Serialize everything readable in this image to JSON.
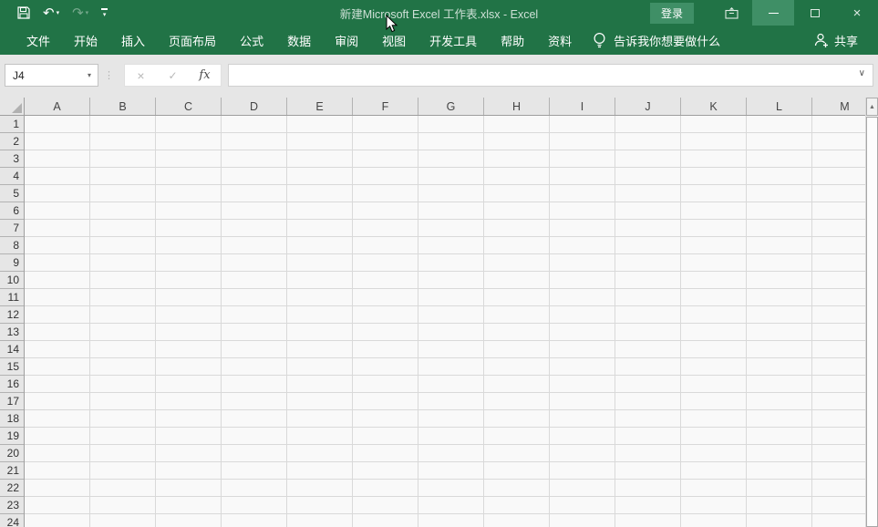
{
  "titlebar": {
    "title": "新建Microsoft Excel 工作表.xlsx - Excel",
    "signin_label": "登录"
  },
  "menubar": {
    "tabs": [
      "文件",
      "开始",
      "插入",
      "页面布局",
      "公式",
      "数据",
      "审阅",
      "视图",
      "开发工具",
      "帮助",
      "资料"
    ],
    "tellme_label": "告诉我你想要做什么",
    "share_label": "共享"
  },
  "formula_bar": {
    "name_box_value": "J4",
    "cancel_glyph": "×",
    "enter_glyph": "✓",
    "fx_label": "fx",
    "expand_glyph": "∨"
  },
  "quick_access": {
    "undo_glyph": "↶",
    "redo_glyph": "↷",
    "caret_glyph": "▾"
  },
  "sheet": {
    "columns": [
      "A",
      "B",
      "C",
      "D",
      "E",
      "F",
      "G",
      "H",
      "I",
      "J",
      "K",
      "L",
      "M"
    ],
    "rows": [
      "1",
      "2",
      "3",
      "4",
      "5",
      "6",
      "7",
      "8",
      "9",
      "10",
      "11",
      "12",
      "13",
      "14",
      "15",
      "16",
      "17",
      "18",
      "19",
      "20",
      "21",
      "22",
      "23",
      "24"
    ],
    "scroll_up_glyph": "▲"
  },
  "colors": {
    "titlebar_green": "#217346",
    "button_light_green": "#3f8f66",
    "toolbar_gray": "#e6e6e6",
    "grid_background": "#f9f9f9",
    "gridline": "#d9d9d9"
  }
}
